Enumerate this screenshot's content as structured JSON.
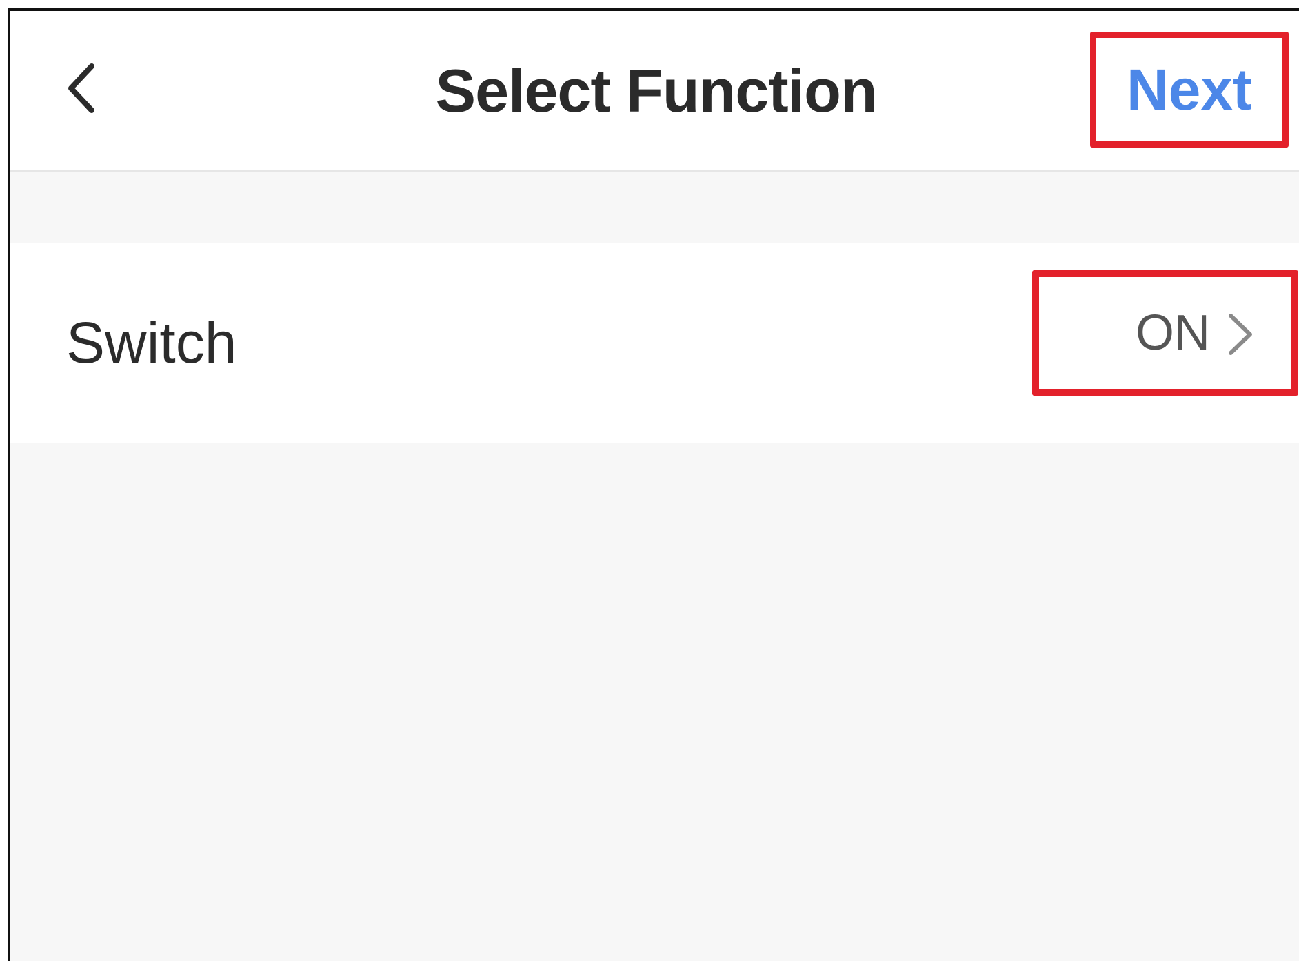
{
  "header": {
    "back_icon": "chevron-left-icon",
    "title": "Select Function",
    "next_label": "Next"
  },
  "function_row": {
    "label": "Switch",
    "value": "ON",
    "chevron_icon": "chevron-right-icon"
  },
  "colors": {
    "accent_blue": "#4c87e8",
    "highlight_red": "#e3212b",
    "title_text": "#2b2b2b",
    "value_text": "#555555",
    "background": "#f7f7f7"
  }
}
